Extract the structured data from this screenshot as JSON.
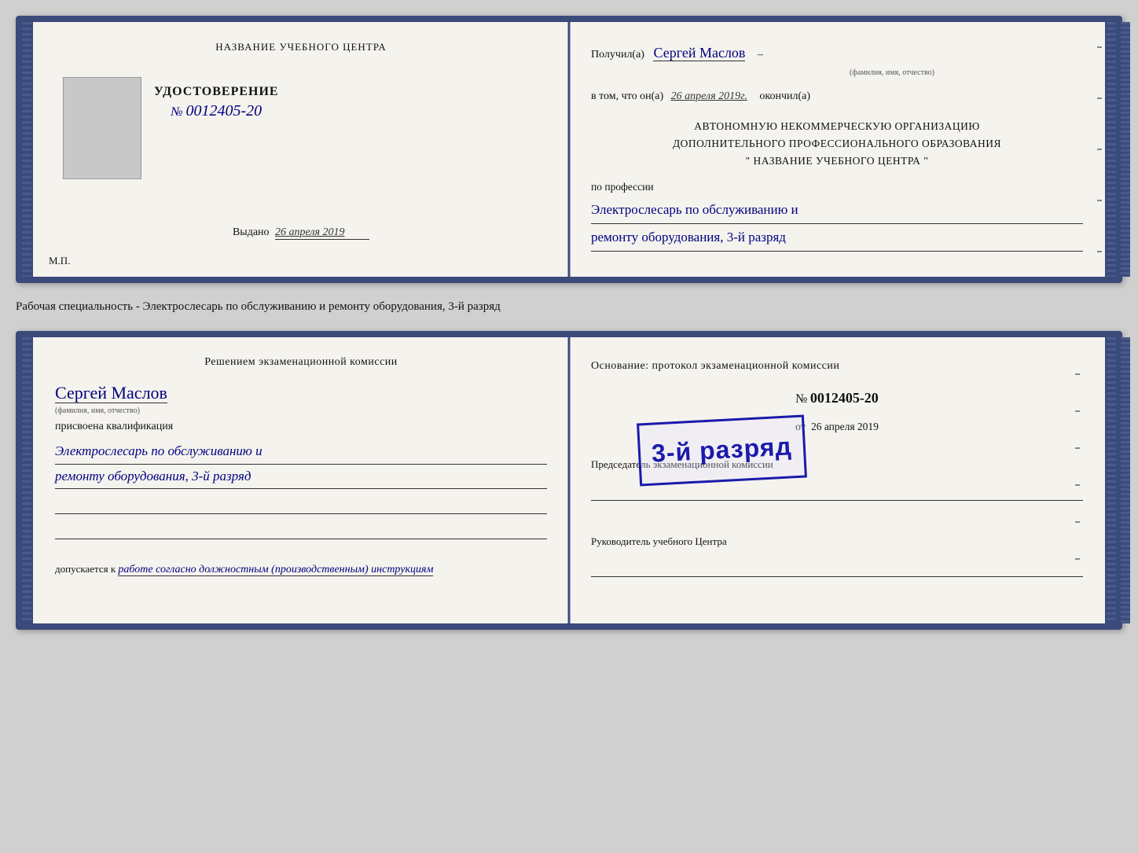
{
  "card1": {
    "left": {
      "center_title": "НАЗВАНИЕ УЧЕБНОГО ЦЕНТРА",
      "udostoverenie_title": "УДОСТОВЕРЕНИЕ",
      "number_label": "№",
      "number": "0012405-20",
      "vydano_label": "Выдано",
      "vydano_date": "26 апреля 2019",
      "mp_label": "М.П."
    },
    "right": {
      "poluchil_label": "Получил(а)",
      "person_name": "Сергей Маслов",
      "fio_label": "(фамилия, имя, отчество)",
      "dash": "–",
      "vtom_prefix": "в том, что он(а)",
      "vtom_date": "26 апреля 2019г.",
      "vtom_suffix": "окончил(а)",
      "avt_line1": "АВТОНОМНУЮ НЕКОММЕРЧЕСКУЮ ОРГАНИЗАЦИЮ",
      "avt_line2": "ДОПОЛНИТЕЛЬНОГО ПРОФЕССИОНАЛЬНОГО ОБРАЗОВАНИЯ",
      "avt_line3": "\"   НАЗВАНИЕ УЧЕБНОГО ЦЕНТРА   \"",
      "po_professii_label": "по профессии",
      "profession_line1": "Электрослесарь по обслуживанию и",
      "profession_line2": "ремонту оборудования, 3-й разряд"
    }
  },
  "between_label": "Рабочая специальность - Электрослесарь по обслуживанию и ремонту оборудования, 3-й разряд",
  "card2": {
    "left": {
      "resheniem_title": "Решением экзаменационной комиссии",
      "person_name": "Сергей Маслов",
      "fio_label": "(фамилия, имя, отчество)",
      "prisvoena_label": "присвоена квалификация",
      "kvalif_line1": "Электрослесарь по обслуживанию и",
      "kvalif_line2": "ремонту оборудования, 3-й разряд",
      "dopuskaetsya_prefix": "допускается к",
      "dopusk_text": "работе согласно должностным (производственным) инструкциям"
    },
    "right": {
      "osnovanie_title": "Основание: протокол экзаменационной комиссии",
      "number_label": "№",
      "number": "0012405-20",
      "ot_label": "от",
      "ot_date": "26 апреля 2019",
      "stamp_text": "3-й разряд",
      "predsedatel_label": "Председатель экзаменационной комиссии",
      "rukovoditel_label": "Руководитель учебного Центра"
    }
  }
}
